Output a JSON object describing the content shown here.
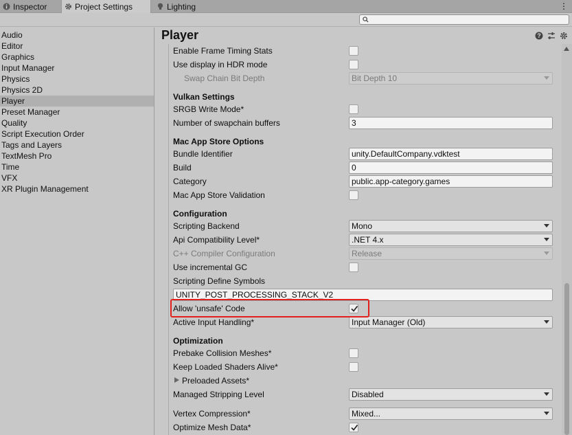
{
  "tabs": [
    {
      "label": "Inspector",
      "icon": "info-icon"
    },
    {
      "label": "Project Settings",
      "icon": "gear-icon"
    },
    {
      "label": "Lighting",
      "icon": "light-bulb-icon"
    }
  ],
  "search": {
    "placeholder": ""
  },
  "nav": {
    "items": [
      {
        "label": "Audio"
      },
      {
        "label": "Editor"
      },
      {
        "label": "Graphics"
      },
      {
        "label": "Input Manager"
      },
      {
        "label": "Physics"
      },
      {
        "label": "Physics 2D"
      },
      {
        "label": "Player",
        "selected": true
      },
      {
        "label": "Preset Manager"
      },
      {
        "label": "Quality"
      },
      {
        "label": "Script Execution Order"
      },
      {
        "label": "Tags and Layers"
      },
      {
        "label": "TextMesh Pro"
      },
      {
        "label": "Time"
      },
      {
        "label": "VFX"
      },
      {
        "label": "XR Plugin Management"
      }
    ]
  },
  "header": {
    "title": "Player",
    "icons": [
      "help-icon",
      "preset-sliders-icon",
      "settings-gear-icon"
    ]
  },
  "settings": {
    "enable_frame_timing": {
      "label": "Enable Frame Timing Stats",
      "checked": false
    },
    "use_hdr": {
      "label": "Use display in HDR mode",
      "checked": false
    },
    "swap_chain_depth": {
      "label": "Swap Chain Bit Depth",
      "value": "Bit Depth 10"
    },
    "vulkan_section": "Vulkan Settings",
    "srgb_write": {
      "label": "SRGB Write Mode*",
      "checked": false
    },
    "swapchain_buffers": {
      "label": "Number of swapchain buffers",
      "value": "3"
    },
    "mac_section": "Mac App Store Options",
    "bundle_id": {
      "label": "Bundle Identifier",
      "value": "unity.DefaultCompany.vdktest"
    },
    "build": {
      "label": "Build",
      "value": "0"
    },
    "category": {
      "label": "Category",
      "value": "public.app-category.games"
    },
    "mac_validation": {
      "label": "Mac App Store Validation",
      "checked": false
    },
    "config_section": "Configuration",
    "scripting_backend": {
      "label": "Scripting Backend",
      "value": "Mono"
    },
    "api_level": {
      "label": "Api Compatibility Level*",
      "value": ".NET 4.x"
    },
    "cpp_config": {
      "label": "C++ Compiler Configuration",
      "value": "Release"
    },
    "incremental_gc": {
      "label": "Use incremental GC",
      "checked": false
    },
    "define_symbols": {
      "label": "Scripting Define Symbols",
      "value": "UNITY_POST_PROCESSING_STACK_V2"
    },
    "unsafe_code": {
      "label": "Allow 'unsafe' Code",
      "checked": true
    },
    "input_handling": {
      "label": "Active Input Handling*",
      "value": "Input Manager (Old)"
    },
    "opt_section": "Optimization",
    "prebake": {
      "label": "Prebake Collision Meshes*",
      "checked": false
    },
    "keep_shaders": {
      "label": "Keep Loaded Shaders Alive*",
      "checked": false
    },
    "preloaded_assets": {
      "label": "Preloaded Assets*"
    },
    "stripping_level": {
      "label": "Managed Stripping Level",
      "value": "Disabled"
    },
    "vertex_compression": {
      "label": "Vertex Compression*",
      "value": "Mixed..."
    },
    "optimize_mesh": {
      "label": "Optimize Mesh Data*",
      "checked": true
    }
  },
  "colors": {
    "highlight": "#e3211c",
    "panel_bg": "#c8c8c8",
    "selected_nav": "#b0b0b0"
  }
}
